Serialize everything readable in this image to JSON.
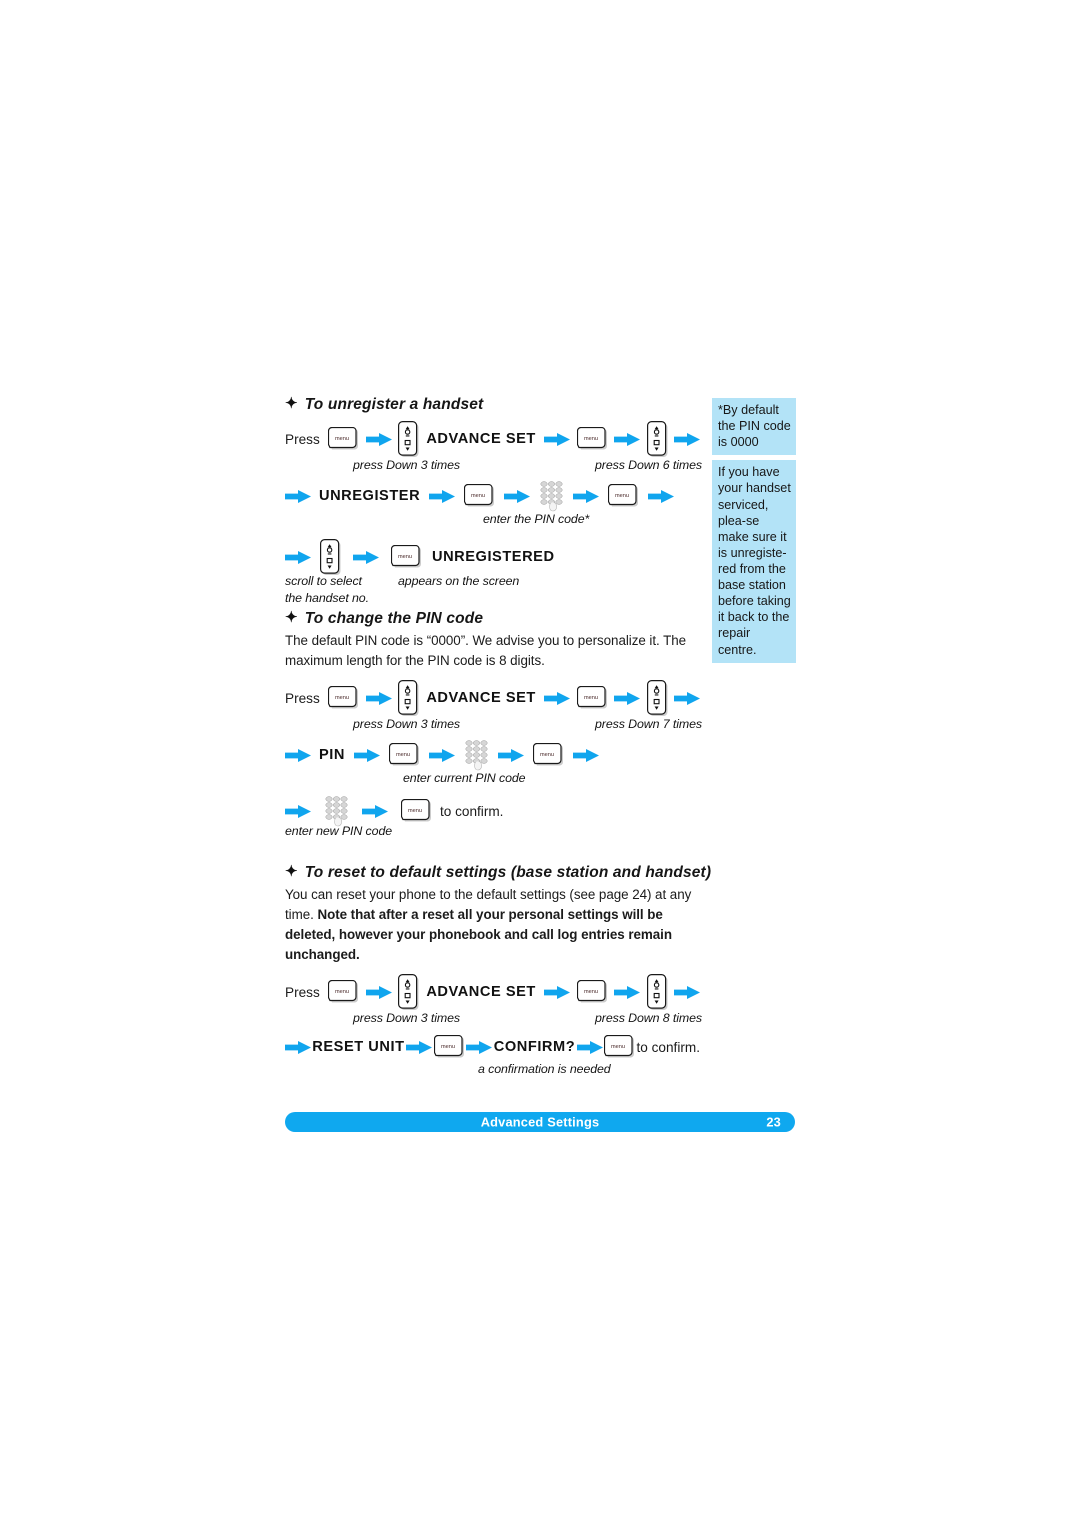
{
  "page": {
    "footer_title": "Advanced Settings",
    "footer_page": "23",
    "accent_blue": "#0fa8ef",
    "note_bg": "#b3e3f7",
    "bullet_glyph": "✦"
  },
  "sections": [
    {
      "id": "unregister",
      "heading": "To unregister a handset",
      "rows": [
        {
          "id": "row1",
          "items": [
            "Press",
            "menu-key",
            "arrow",
            "updown-key",
            "ADVANCE SET",
            "arrow",
            "menu-key",
            "arrow",
            "updown-key",
            "arrow"
          ],
          "captions": [
            "press Down 3 times",
            "press Down 6  times"
          ]
        },
        {
          "id": "row2",
          "items": [
            "arrow",
            "UNREGISTER",
            "arrow",
            "menu-key",
            "arrow",
            "keypad",
            "arrow",
            "menu-key",
            "arrow"
          ],
          "captions": [
            "enter the PIN code*"
          ]
        },
        {
          "id": "row3",
          "items": [
            "arrow",
            "updown-key",
            "arrow",
            "menu-key",
            "UNREGISTERED"
          ],
          "captions": [
            "scroll to select",
            "the handset no.",
            "appears on the screen"
          ]
        }
      ]
    },
    {
      "id": "pin",
      "heading": "To change the PIN code",
      "paragraph": "The default PIN code is “0000”. We advise you to personalize it. The maximum length for the PIN code is 8 digits.",
      "rows": [
        {
          "id": "row1",
          "items": [
            "Press",
            "menu-key",
            "arrow",
            "updown-key",
            "ADVANCE SET",
            "arrow",
            "menu-key",
            "arrow",
            "updown-key",
            "arrow"
          ],
          "captions": [
            "press Down 3 times",
            "press Down 7  times"
          ]
        },
        {
          "id": "row2",
          "items": [
            "arrow",
            "PIN",
            "arrow",
            "menu-key",
            "arrow",
            "keypad",
            "arrow",
            "menu-key",
            "arrow"
          ],
          "captions": [
            "enter current PIN code"
          ]
        },
        {
          "id": "row3",
          "items": [
            "arrow",
            "keypad",
            "arrow",
            "menu-key",
            "to confirm."
          ],
          "captions": [
            "enter new PIN code"
          ]
        }
      ]
    },
    {
      "id": "reset",
      "heading": "To reset to default settings (base station and handset)",
      "paragraph_normal": "You can reset your phone to the default settings (see page 24) at any time. ",
      "paragraph_bold": "Note that after a reset all your personal settings will be deleted, however your phonebook and call log entries remain unchanged.",
      "rows": [
        {
          "id": "row1",
          "items": [
            "Press",
            "menu-key",
            "arrow",
            "updown-key",
            "ADVANCE SET",
            "arrow",
            "menu-key",
            "arrow",
            "updown-key",
            "arrow"
          ],
          "captions": [
            "press Down 3 times",
            "press Down 8  times"
          ]
        },
        {
          "id": "row2",
          "items": [
            "arrow",
            "RESET UNIT",
            "arrow",
            "menu-key",
            "arrow",
            "CONFIRM?",
            "arrow",
            "menu-key",
            "to confirm."
          ],
          "captions": [
            "a confirmation is needed"
          ]
        }
      ]
    }
  ],
  "labels": {
    "press": "Press",
    "advance_set": "ADVANCE SET",
    "unregister": "UNREGISTER",
    "unregistered": "UNREGISTERED",
    "pin": "PIN",
    "reset_unit": "RESET UNIT",
    "confirm_q": "CONFIRM?",
    "to_confirm": "to confirm.",
    "menu_key_text": "menu"
  },
  "captions": {
    "down3_a": "press Down 3 times",
    "down6": "press Down 6  times",
    "enter_pin_star": "enter the PIN code*",
    "scroll_select": "scroll to select",
    "handset_no": "the handset no.",
    "appears_screen": "appears on the screen",
    "down3_b": "press Down 3 times",
    "down7": "press Down 7  times",
    "enter_current_pin": "enter current PIN code",
    "enter_new_pin": "enter new PIN code",
    "down3_c": "press Down 3 times",
    "down8": "press Down 8  times",
    "confirmation_needed": "a confirmation is needed"
  },
  "headings": {
    "unregister": "To unregister a handset",
    "pin": "To change the PIN code",
    "reset": "To reset to default settings (base station and handset)"
  },
  "paragraphs": {
    "pin": "The default PIN code is “0000”. We advise you to personalize it. The maximum length for the PIN code is 8 digits.",
    "reset_normal": "You can reset your phone to the default settings (see page 24) at any time. ",
    "reset_bold": "Note that after a reset all your personal settings will be deleted, however your phonebook and call log entries remain unchanged."
  },
  "notes": [
    {
      "id": "note-pin-default",
      "text": "*By default the PIN code is 0000"
    },
    {
      "id": "note-service",
      "text": "If you have your handset serviced, plea-se make sure it is unregiste-red from the base station before taking it back to the repair centre."
    }
  ]
}
